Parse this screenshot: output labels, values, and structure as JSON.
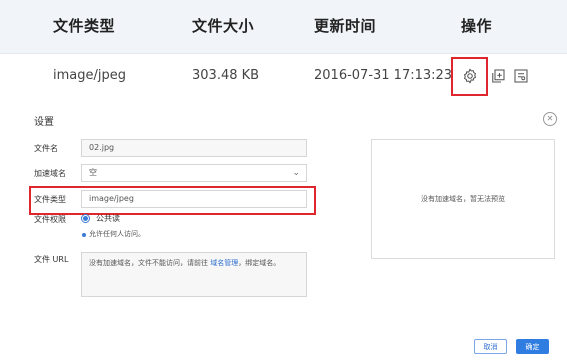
{
  "table": {
    "headers": [
      "文件类型",
      "文件大小",
      "更新时间",
      "操作"
    ],
    "row": {
      "type": "image/jpeg",
      "size": "303.48 KB",
      "updated": "2016-07-31 17:13:23"
    },
    "actions": [
      {
        "icon": "gear-icon"
      },
      {
        "icon": "copy-icon"
      },
      {
        "icon": "preview-icon"
      }
    ]
  },
  "settings": {
    "title": "设置",
    "fields": {
      "filename_label": "文件名",
      "filename_value": "02.jpg",
      "domain_label": "加速域名",
      "domain_value": "空",
      "filetype_label": "文件类型",
      "filetype_value": "image/jpeg",
      "permission_label": "文件权限",
      "permission_option": "公共读",
      "permission_hint": "允许任何人访问。",
      "url_label": "文件 URL",
      "url_text_before": "没有加速域名，文件不能访问，请前往 ",
      "url_link": "域名管理",
      "url_text_after": "，绑定域名。"
    },
    "preview_text": "没有加速域名，暂无法预览",
    "buttons": {
      "cancel": "取消",
      "ok": "确定"
    }
  },
  "colors": {
    "highlight": "#e0262d",
    "accent": "#2f7de1"
  }
}
